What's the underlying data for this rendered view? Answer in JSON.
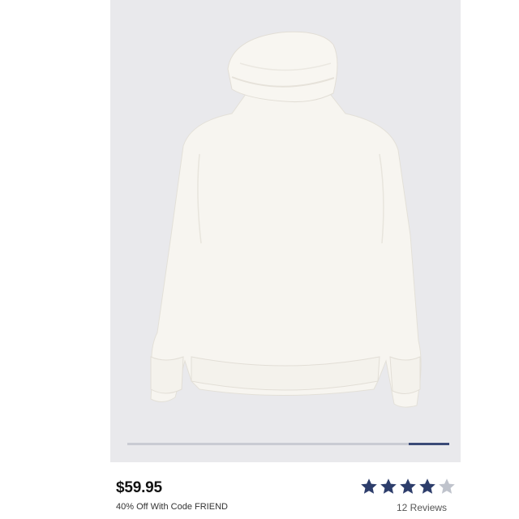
{
  "product": {
    "image_description_icon": "turtleneck-sweater-photo",
    "price": "$59.95",
    "promo": "40% Off With Code FRIEND",
    "rating_value": 4,
    "rating_max": 5,
    "reviews": "12 Reviews"
  },
  "carousel": {
    "position_fraction_start": 0.875,
    "position_fraction_end": 1.0
  },
  "colors": {
    "image_bg": "#e9e9ec",
    "star_filled": "#2d3d6b",
    "star_empty": "#bfc3cc",
    "carousel_active": "#3b4b77"
  }
}
